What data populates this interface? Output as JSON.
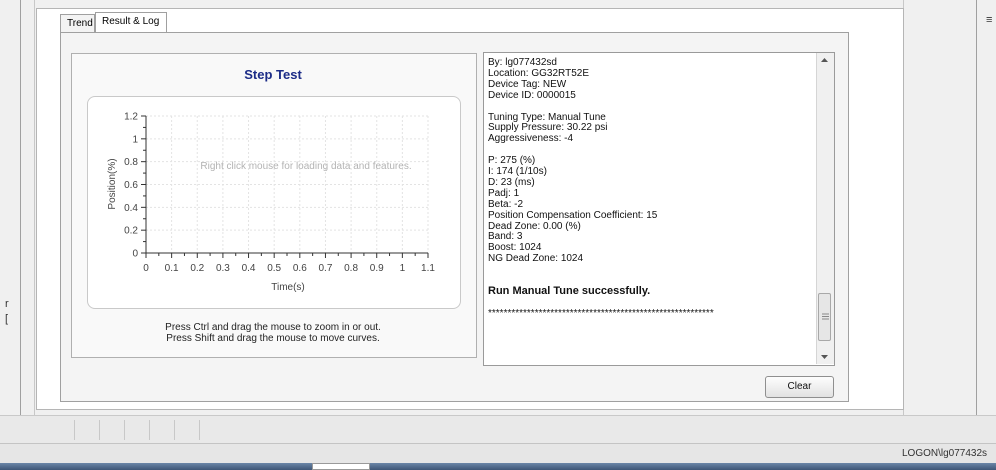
{
  "tabs": [
    {
      "label": "Trend"
    },
    {
      "label": "Result & Log"
    }
  ],
  "chart": {
    "title": "Step Test",
    "overlay": "Right click mouse for loading data and features.",
    "hint_line1": "Press Ctrl and drag the mouse to zoom in or out.",
    "hint_line2": "Press Shift and drag the mouse to move curves."
  },
  "chart_data": {
    "type": "line",
    "title": "Step Test",
    "xlabel": "Time(s)",
    "ylabel": "Position(%)",
    "x_ticks": [
      "0",
      "0.1",
      "0.2",
      "0.3",
      "0.4",
      "0.5",
      "0.6",
      "0.7",
      "0.8",
      "0.9",
      "1",
      "1.1"
    ],
    "y_ticks": [
      "0",
      "0.2",
      "0.4",
      "0.6",
      "0.8",
      "1",
      "1.2"
    ],
    "xlim": [
      0,
      1.1
    ],
    "ylim": [
      0,
      1.2
    ],
    "grid": true,
    "series": []
  },
  "log": {
    "lines": [
      {
        "text": "By: lg077432sd",
        "bold": false
      },
      {
        "text": "Location: GG32RT52E",
        "bold": false
      },
      {
        "text": "Device Tag: NEW",
        "bold": false
      },
      {
        "text": "Device ID: 0000015",
        "bold": false
      },
      {
        "text": "",
        "bold": false
      },
      {
        "text": "Tuning Type: Manual Tune",
        "bold": false
      },
      {
        "text": "Supply Pressure: 30.22 psi",
        "bold": false
      },
      {
        "text": "Aggressiveness: -4",
        "bold": false
      },
      {
        "text": "",
        "bold": false
      },
      {
        "text": "P: 275 (%)",
        "bold": false
      },
      {
        "text": "I: 174 (1/10s)",
        "bold": false
      },
      {
        "text": "D: 23 (ms)",
        "bold": false
      },
      {
        "text": "Padj: 1",
        "bold": false
      },
      {
        "text": "Beta: -2",
        "bold": false
      },
      {
        "text": "Position Compensation Coefficient: 15",
        "bold": false
      },
      {
        "text": "Dead Zone: 0.00 (%)",
        "bold": false
      },
      {
        "text": "Band: 3",
        "bold": false
      },
      {
        "text": "Boost: 1024",
        "bold": false
      },
      {
        "text": "NG Dead Zone: 1024",
        "bold": false
      },
      {
        "text": "",
        "bold": false
      },
      {
        "text": "",
        "bold": false
      },
      {
        "text": "Run Manual Tune successfully.",
        "bold": true
      },
      {
        "text": "",
        "bold": false
      },
      {
        "text": "**********************************************************",
        "bold": false
      }
    ]
  },
  "buttons": {
    "clear": "Clear"
  },
  "status": {
    "logon": "LOGON\\lg077432s"
  },
  "edge": {
    "left_char1": "r",
    "left_char2": "[",
    "right_char": "≡"
  },
  "colors": {
    "chart_title": "#1c2c87",
    "taskbar": "#3e5676"
  },
  "icons": {
    "scroll_up": "scroll-up-arrow-icon",
    "scroll_down": "scroll-down-arrow-icon",
    "grip": "scroll-grip-icon"
  }
}
